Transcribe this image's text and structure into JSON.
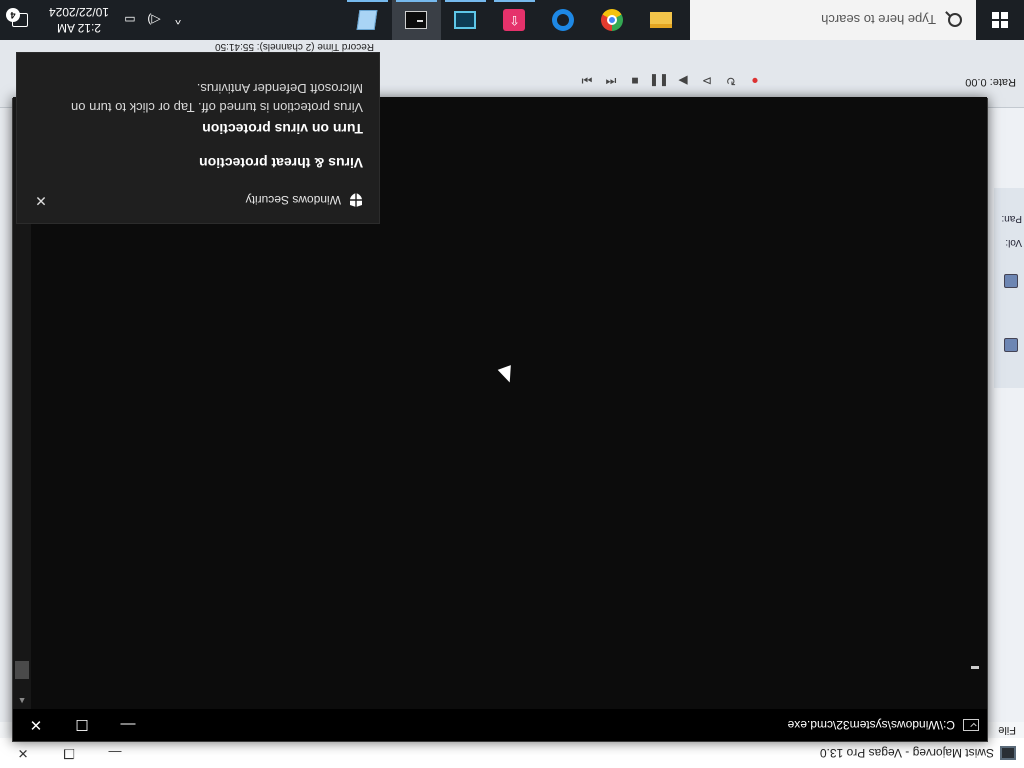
{
  "vegas": {
    "title": "Swist Majorveg - Vegas Pro 13.0",
    "menu_first": "File",
    "rate_label": "Rate: 0.00",
    "record_time": "Record Time (2 channels): 55:41:50",
    "vol_label": "Vol:",
    "pan_label": "Pan:",
    "transport_icons": [
      "record-icon",
      "loop-icon",
      "play-from-start-icon",
      "play-icon",
      "pause-icon",
      "stop-icon",
      "prev-frame-icon",
      "next-frame-icon",
      "go-start-icon",
      "go-end-icon"
    ]
  },
  "cmd": {
    "title": "C:\\Windows\\system32\\cmd.exe",
    "minimize_glyph": "—",
    "maximize_glyph": "☐",
    "close_glyph": "✕"
  },
  "toast": {
    "app_name": "Windows Security",
    "title": "Virus & threat protection",
    "subtitle": "Turn on virus protection",
    "message": "Virus protection is turned off. Tap or click to turn on Microsoft Defender Antivirus.",
    "close_glyph": "✕"
  },
  "taskbar": {
    "search_placeholder": "Type here to search",
    "apps": [
      {
        "name": "file-explorer-icon",
        "running": false,
        "active": false
      },
      {
        "name": "chrome-icon",
        "running": false,
        "active": false
      },
      {
        "name": "edge-icon",
        "running": false,
        "active": false
      },
      {
        "name": "upload-app-icon",
        "running": true,
        "active": false
      },
      {
        "name": "video-editor-icon",
        "running": true,
        "active": false
      },
      {
        "name": "cmd-icon",
        "running": true,
        "active": true
      },
      {
        "name": "notes-app-icon",
        "running": true,
        "active": false
      }
    ],
    "time": "2:12 AM",
    "date": "10/22/2024",
    "notification_count": "4",
    "chevron_glyph": "^",
    "volume_glyph": "◁)",
    "network_glyph": "▭"
  },
  "colors": {
    "taskbar_bg": "#1b1f24",
    "cmd_bg": "#0c0c0c",
    "toast_bg": "#1f1f1f",
    "accent": "#76b9ed"
  }
}
